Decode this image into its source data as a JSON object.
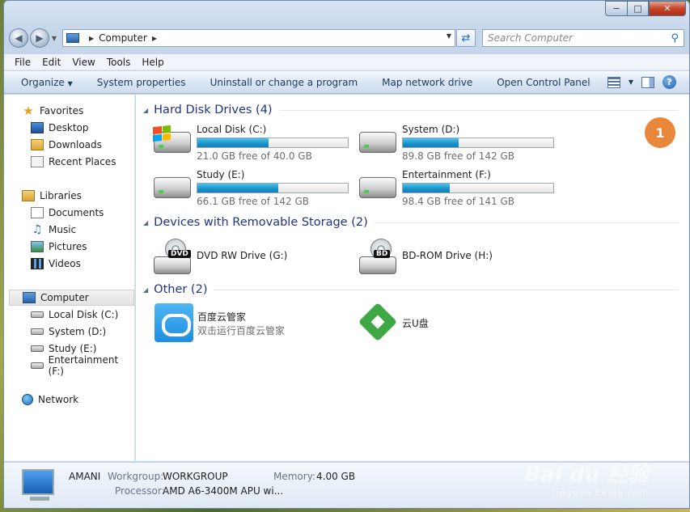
{
  "window": {
    "caption": {
      "minimize": "−",
      "maximize": "□",
      "close": "✕"
    }
  },
  "address_bar": {
    "location": "Computer"
  },
  "search": {
    "placeholder": "Search Computer"
  },
  "menu": [
    "File",
    "Edit",
    "View",
    "Tools",
    "Help"
  ],
  "commands": {
    "organize": "Organize",
    "items": [
      "System properties",
      "Uninstall or change a program",
      "Map network drive",
      "Open Control Panel"
    ]
  },
  "sidebar": {
    "favorites": "Favorites",
    "desktop": "Desktop",
    "downloads": "Downloads",
    "recent": "Recent Places",
    "libraries": "Libraries",
    "documents": "Documents",
    "music": "Music",
    "pictures": "Pictures",
    "videos": "Videos",
    "computer": "Computer",
    "drive_c": "Local Disk (C:)",
    "drive_d": "System (D:)",
    "drive_e": "Study (E:)",
    "drive_f": "Entertainment (F:)",
    "network": "Network"
  },
  "groups": {
    "hdd": "Hard Disk Drives (4)",
    "removable": "Devices with Removable Storage (2)",
    "other": "Other (2)"
  },
  "drives": [
    {
      "name": "Local Disk (C:)",
      "free": "21.0 GB free of 40.0 GB",
      "used_fraction": 0.475
    },
    {
      "name": "System (D:)",
      "free": "89.8 GB free of 142 GB",
      "used_fraction": 0.37
    },
    {
      "name": "Study (E:)",
      "free": "66.1 GB free of 142 GB",
      "used_fraction": 0.535
    },
    {
      "name": "Entertainment (F:)",
      "free": "98.4 GB free of 141 GB",
      "used_fraction": 0.31
    }
  ],
  "removable": [
    {
      "name": "DVD RW Drive (G:)",
      "tag": "DVD"
    },
    {
      "name": "BD-ROM Drive (H:)",
      "tag": "BD"
    }
  ],
  "other": [
    {
      "name": "百度云管家",
      "sub": "双击运行百度云管家"
    },
    {
      "name": "云U盘"
    }
  ],
  "badge": "1",
  "details": {
    "computer_name": "AMANI",
    "workgroup_label": "Workgroup:",
    "workgroup": "WORKGROUP",
    "memory_label": "Memory:",
    "memory": "4.00 GB",
    "processor_label": "Processor:",
    "processor": "AMD A6-3400M APU wi..."
  },
  "watermark": {
    "brand": "Bai du 经验",
    "url": "jingyan.baidu.com"
  },
  "colors": {
    "bar_fill": "#1b8fc7",
    "badge": "#e8863a",
    "group_title": "#1e3287"
  }
}
